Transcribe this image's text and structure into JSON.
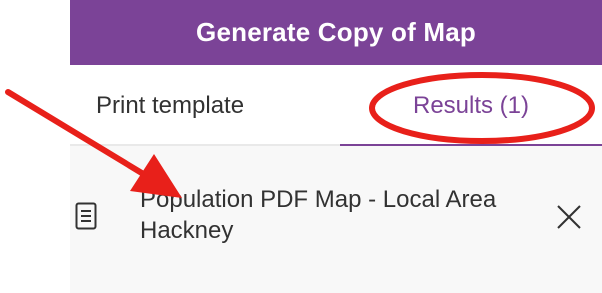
{
  "panel": {
    "title": "Generate Copy of Map"
  },
  "tabs": [
    {
      "label": "Print template",
      "active": false
    },
    {
      "label": "Results (1)",
      "active": true
    }
  ],
  "results": [
    {
      "title": "Population PDF Map - Local Area Hackney",
      "icon": "document-icon",
      "action_icon": "close-icon"
    }
  ],
  "colors": {
    "accent": "#7b4397",
    "annotation": "#e8201a",
    "row_background": "#f8f8f8"
  }
}
